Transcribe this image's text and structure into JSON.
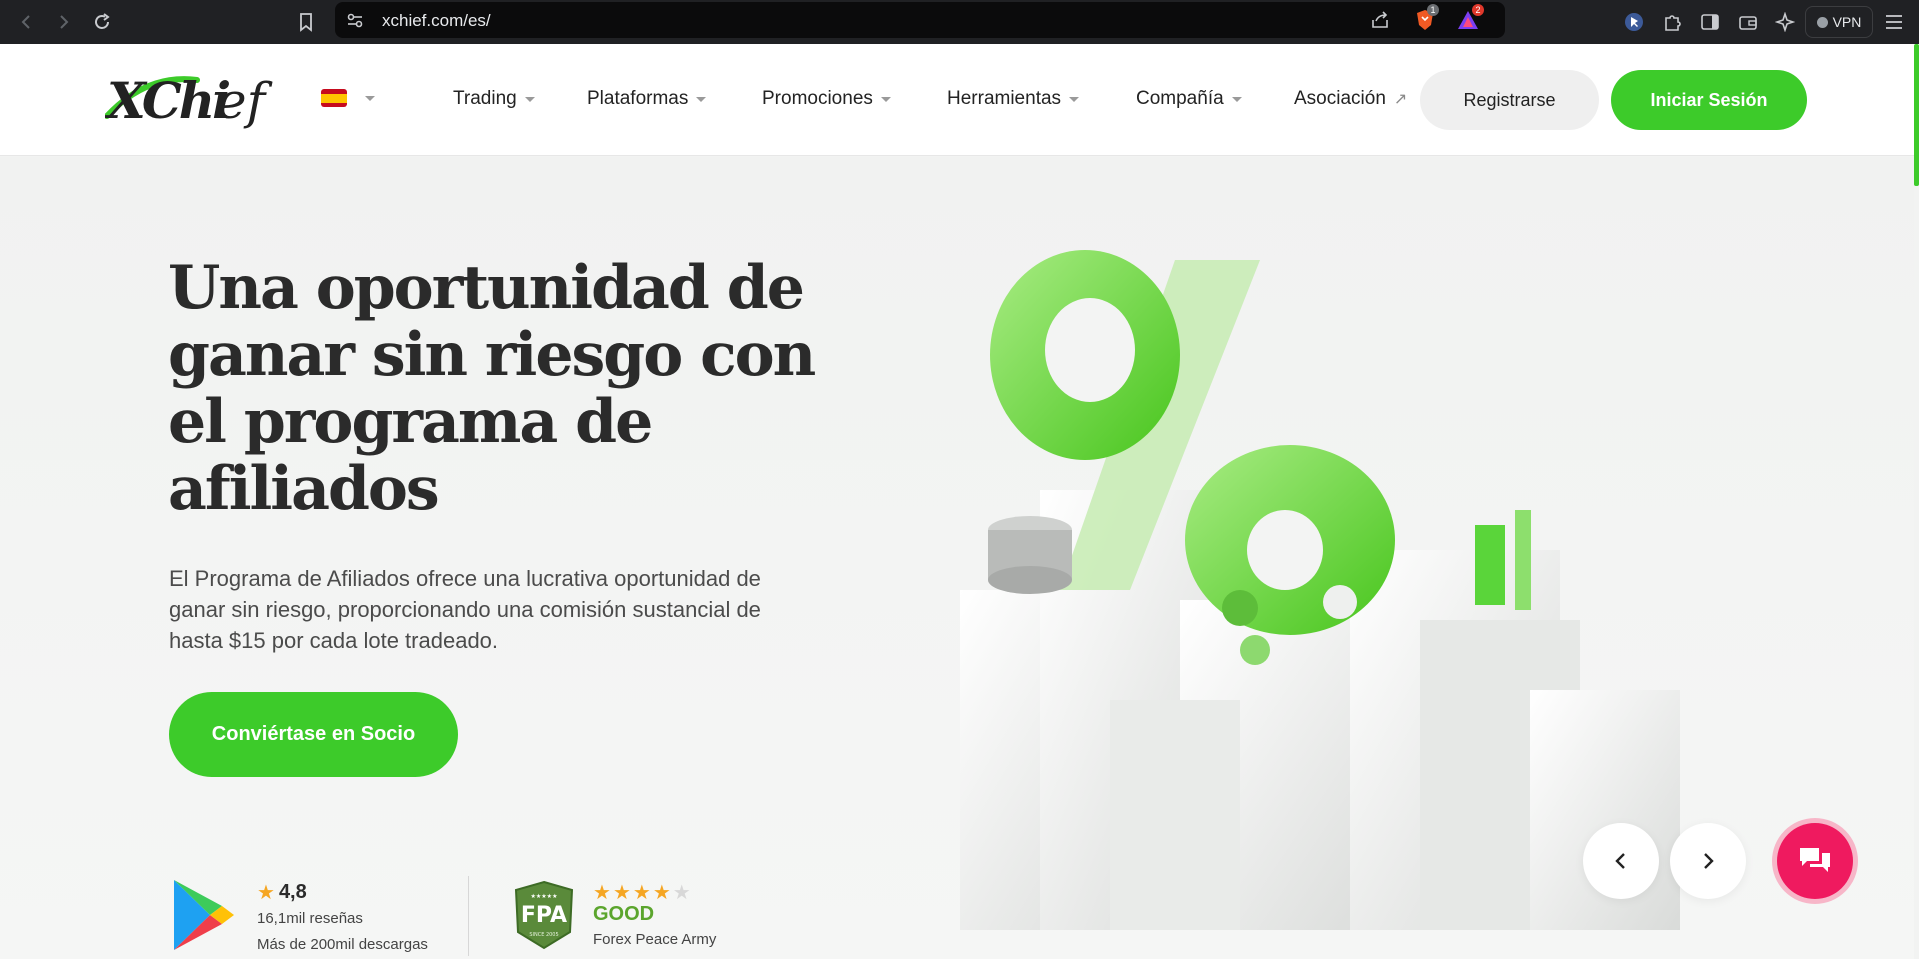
{
  "browser": {
    "url": "xchief.com/es/",
    "shields_badge": "1",
    "alerts_badge": "2",
    "vpn_label": "VPN"
  },
  "header": {
    "logo_text": "XChief",
    "language": "es",
    "nav": [
      {
        "label": "Trading"
      },
      {
        "label": "Plataformas"
      },
      {
        "label": "Promociones"
      },
      {
        "label": "Herramientas"
      },
      {
        "label": "Compañía"
      },
      {
        "label": "Asociación"
      }
    ],
    "register_label": "Registrarse",
    "login_label": "Iniciar Sesión"
  },
  "hero": {
    "title": "Una oportunidad de ganar sin riesgo con el programa de afiliados",
    "subtitle": "El Programa de Afiliados ofrece una lucrativa oportunidad de ganar sin riesgo, proporcionando una comisión sustancial de hasta $15 por cada lote tradeado.",
    "cta_label": "Conviértase en Socio"
  },
  "ratings": {
    "play": {
      "score": "4,8",
      "reviews": "16,1mil reseñas",
      "downloads": "Más de 200mil descargas"
    },
    "fpa": {
      "stars_filled": 4,
      "stars_total": 5,
      "badge_text": "FPA",
      "badge_since": "SINCE 2005",
      "label": "GOOD",
      "name": "Forex Peace Army"
    }
  },
  "colors": {
    "brand_green": "#3dcb2a",
    "chat_pink": "#ef1a5f",
    "star_orange": "#f5a623"
  },
  "icons": [
    "back-icon",
    "forward-icon",
    "reload-icon",
    "bookmark-icon",
    "site-settings-icon",
    "share-icon",
    "brave-shields-icon",
    "rewards-icon",
    "extension-icon",
    "puzzle-icon",
    "sidebar-icon",
    "wallet-icon",
    "leo-icon",
    "menu-icon",
    "chevron-left-icon",
    "chevron-right-icon",
    "chat-icon"
  ]
}
